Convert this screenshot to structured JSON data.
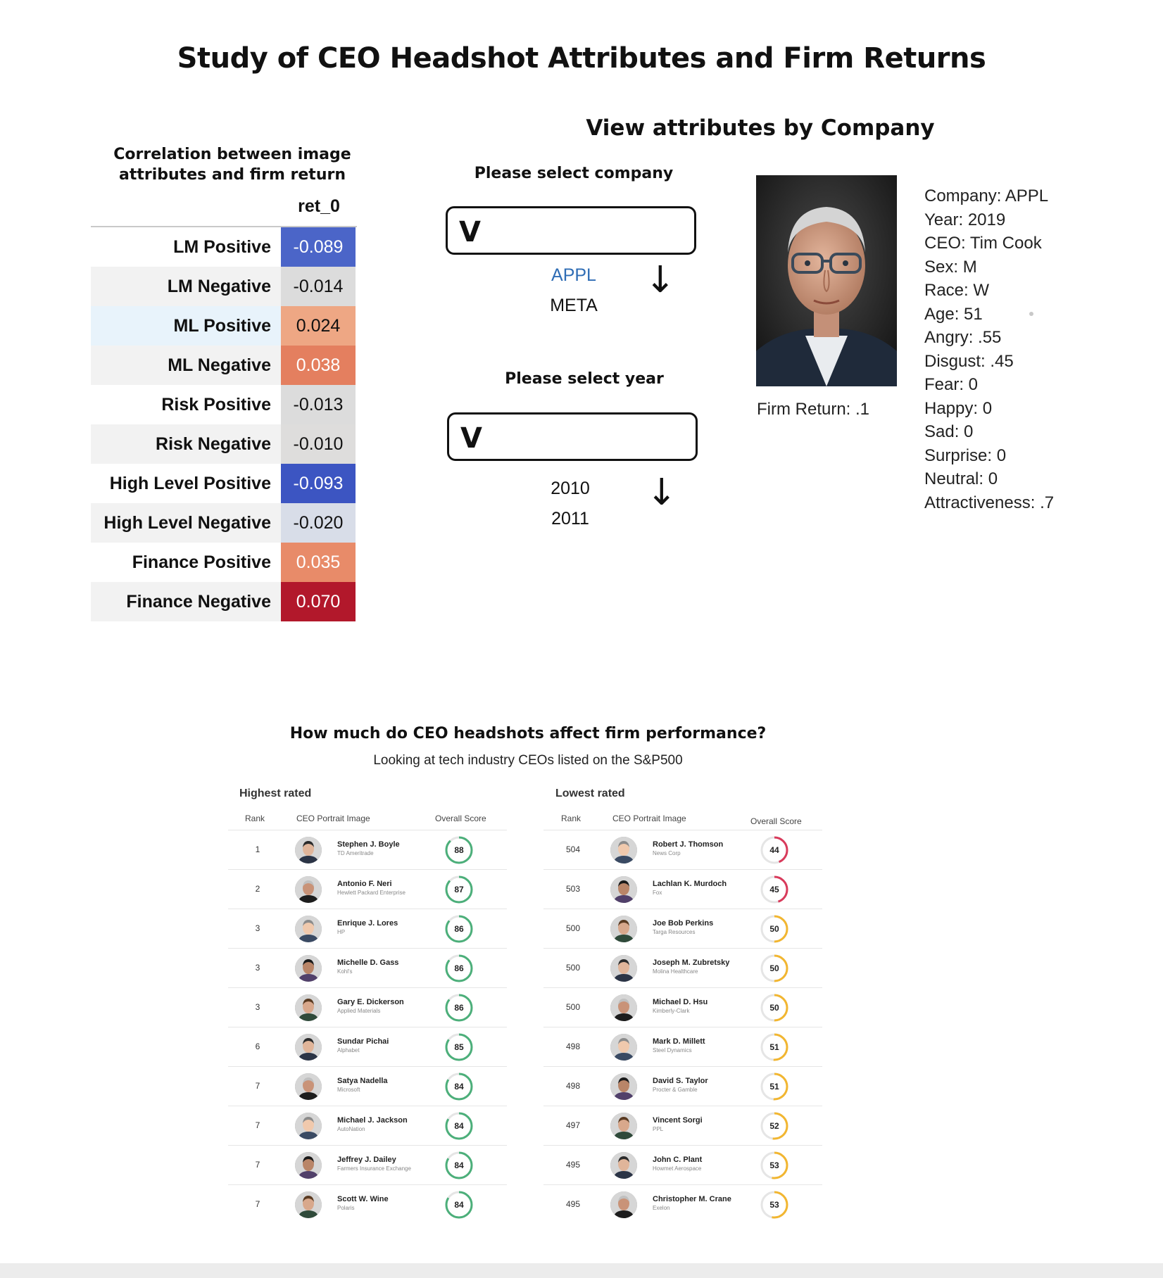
{
  "page": {
    "title": "Study of CEO Headshot Attributes and Firm Returns"
  },
  "correlation": {
    "title_line1": "Correlation between image",
    "title_line2": "attributes and firm return",
    "column": "ret_0",
    "rows": [
      {
        "label": "LM Positive",
        "value": "-0.089",
        "bg": "#4b65c8",
        "fg": "#ffffff",
        "label_bg": "#ffffff"
      },
      {
        "label": "LM Negative",
        "value": "-0.014",
        "bg": "#dcdcdc",
        "fg": "#111111",
        "label_bg": "#f2f2f2"
      },
      {
        "label": "ML Positive",
        "value": "0.024",
        "bg": "#eea784",
        "fg": "#111111",
        "label_bg": "#e8f3fb"
      },
      {
        "label": "ML Negative",
        "value": "0.038",
        "bg": "#e47f5f",
        "fg": "#ffffff",
        "label_bg": "#f2f2f2"
      },
      {
        "label": "Risk Positive",
        "value": "-0.013",
        "bg": "#dcdcdc",
        "fg": "#111111",
        "label_bg": "#ffffff"
      },
      {
        "label": "Risk Negative",
        "value": "-0.010",
        "bg": "#dedddc",
        "fg": "#111111",
        "label_bg": "#f2f2f2"
      },
      {
        "label": "High Level Positive",
        "value": "-0.093",
        "bg": "#3c55c2",
        "fg": "#ffffff",
        "label_bg": "#ffffff"
      },
      {
        "label": "High Level Negative",
        "value": "-0.020",
        "bg": "#d8dde8",
        "fg": "#111111",
        "label_bg": "#f2f2f2"
      },
      {
        "label": "Finance Positive",
        "value": "0.035",
        "bg": "#e88b69",
        "fg": "#ffffff",
        "label_bg": "#ffffff"
      },
      {
        "label": "Finance Negative",
        "value": "0.070",
        "bg": "#b2182b",
        "fg": "#ffffff",
        "label_bg": "#f2f2f2"
      }
    ]
  },
  "company_view": {
    "title": "View attributes by Company",
    "company_select": {
      "label": "Please select company",
      "value": "V",
      "options": [
        "APPL",
        "META"
      ],
      "active_color": "#2f6db5"
    },
    "year_select": {
      "label": "Please select year",
      "value": "V",
      "options": [
        "2010",
        "2011"
      ]
    },
    "firm_return": "Firm Return: .1",
    "attributes": [
      "Company: APPL",
      "Year: 2019",
      "CEO: Tim Cook",
      "Sex: M",
      "Race: W",
      "Age: 51",
      "Angry: .55",
      "Disgust: .45",
      "Fear: 0",
      "Happy: 0",
      "Sad: 0",
      "Surprise: 0",
      "Neutral: 0",
      "Attractiveness: .7"
    ]
  },
  "rankings": {
    "title": "How much do CEO headshots affect firm performance?",
    "subtitle": "Looking at tech industry CEOs listed on the S&P500",
    "highest": {
      "title": "Highest rated",
      "headers": {
        "rank": "Rank",
        "image": "CEO Portrait Image",
        "score": "Overall Score"
      },
      "rows": [
        {
          "rank": "1",
          "name": "Stephen J. Boyle",
          "company": "TD Ameritrade",
          "score": "88"
        },
        {
          "rank": "2",
          "name": "Antonio F. Neri",
          "company": "Hewlett Packard Enterprise",
          "score": "87"
        },
        {
          "rank": "3",
          "name": "Enrique J. Lores",
          "company": "HP",
          "score": "86"
        },
        {
          "rank": "3",
          "name": "Michelle D. Gass",
          "company": "Kohl's",
          "score": "86"
        },
        {
          "rank": "3",
          "name": "Gary E. Dickerson",
          "company": "Applied Materials",
          "score": "86"
        },
        {
          "rank": "6",
          "name": "Sundar Pichai",
          "company": "Alphabet",
          "score": "85"
        },
        {
          "rank": "7",
          "name": "Satya Nadella",
          "company": "Microsoft",
          "score": "84"
        },
        {
          "rank": "7",
          "name": "Michael J. Jackson",
          "company": "AutoNation",
          "score": "84"
        },
        {
          "rank": "7",
          "name": "Jeffrey J. Dailey",
          "company": "Farmers Insurance Exchange",
          "score": "84"
        },
        {
          "rank": "7",
          "name": "Scott W. Wine",
          "company": "Polaris",
          "score": "84"
        }
      ]
    },
    "lowest": {
      "title": "Lowest rated",
      "headers": {
        "rank": "Rank",
        "image": "CEO Portrait Image",
        "score": "Overall Score"
      },
      "rows": [
        {
          "rank": "504",
          "name": "Robert J. Thomson",
          "company": "News Corp",
          "score": "44"
        },
        {
          "rank": "503",
          "name": "Lachlan K. Murdoch",
          "company": "Fox",
          "score": "45"
        },
        {
          "rank": "500",
          "name": "Joe Bob Perkins",
          "company": "Targa Resources",
          "score": "50"
        },
        {
          "rank": "500",
          "name": "Joseph M. Zubretsky",
          "company": "Molina Healthcare",
          "score": "50"
        },
        {
          "rank": "500",
          "name": "Michael D. Hsu",
          "company": "Kimberly-Clark",
          "score": "50"
        },
        {
          "rank": "498",
          "name": "Mark D. Millett",
          "company": "Steel Dynamics",
          "score": "51"
        },
        {
          "rank": "498",
          "name": "David S. Taylor",
          "company": "Procter & Gamble",
          "score": "51"
        },
        {
          "rank": "497",
          "name": "Vincent Sorgi",
          "company": "PPL",
          "score": "52"
        },
        {
          "rank": "495",
          "name": "John C. Plant",
          "company": "Howmet Aerospace",
          "score": "53"
        },
        {
          "rank": "495",
          "name": "Christopher M. Crane",
          "company": "Exelon",
          "score": "53"
        }
      ]
    },
    "score_colors": {
      "high": "#4caf7a",
      "mid": "#f2b630",
      "low": "#d93a5b",
      "track": "#e5e5e5"
    }
  }
}
